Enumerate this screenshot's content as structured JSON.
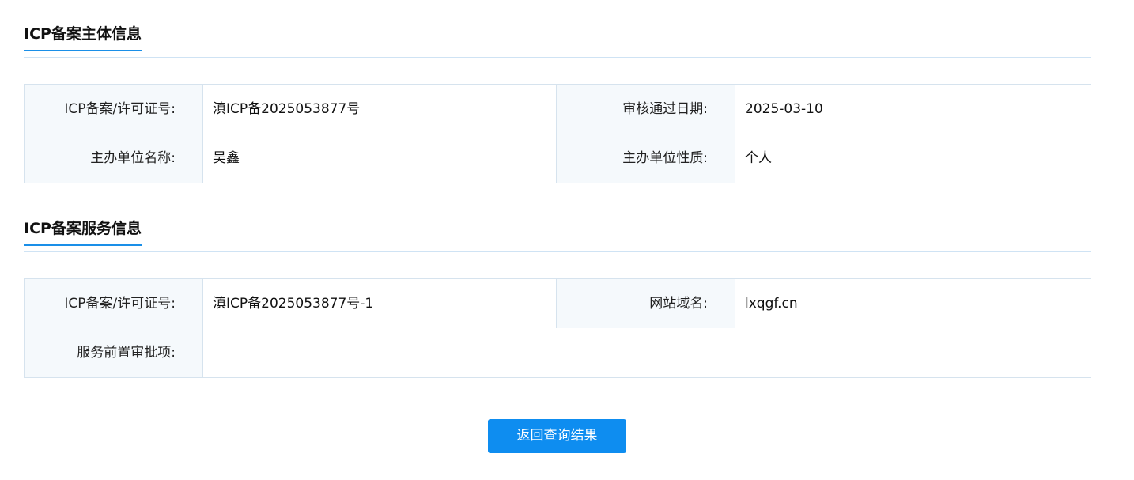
{
  "entity_section": {
    "title": "ICP备案主体信息",
    "rows": [
      {
        "label_a": "ICP备案/许可证号:",
        "value_a": "滇ICP备2025053877号",
        "label_b": "审核通过日期:",
        "value_b": "2025-03-10"
      },
      {
        "label_a": "主办单位名称:",
        "value_a": "吴鑫",
        "label_b": "主办单位性质:",
        "value_b": "个人"
      }
    ]
  },
  "service_section": {
    "title": "ICP备案服务信息",
    "rows": [
      {
        "label_a": "ICP备案/许可证号:",
        "value_a": "滇ICP备2025053877号-1",
        "label_b": "网站域名:",
        "value_b": "lxqgf.cn"
      },
      {
        "label_a": "服务前置审批项:",
        "value_a": ""
      }
    ]
  },
  "actions": {
    "back_label": "返回查询结果"
  },
  "colors": {
    "accent": "#0e8df0",
    "label_bg": "#f5f9fc",
    "border": "#d6e3ee"
  }
}
